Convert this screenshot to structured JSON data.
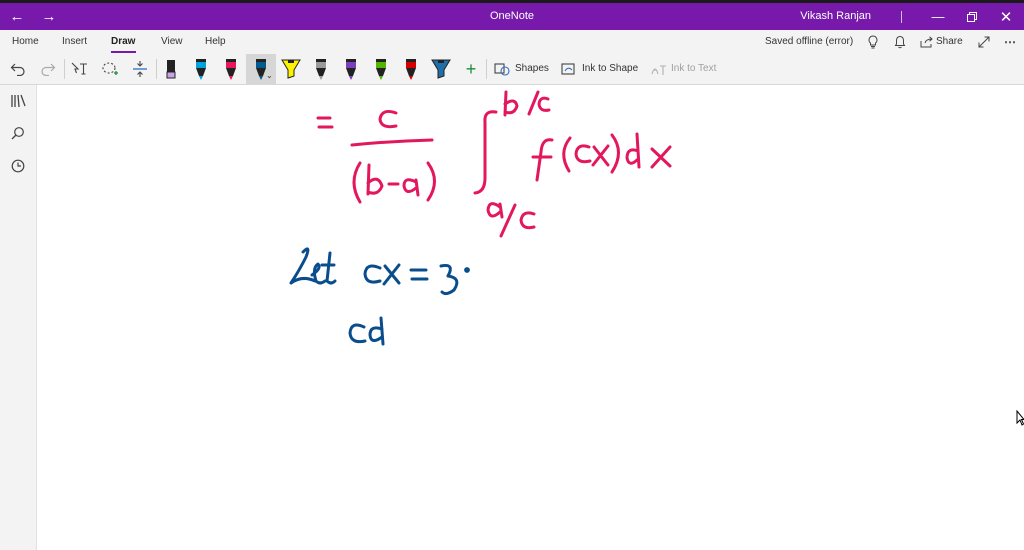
{
  "window": {
    "title": "OneNote",
    "user": "Vikash Ranjan"
  },
  "ribbon": {
    "tabs": [
      "Home",
      "Insert",
      "Draw",
      "View",
      "Help"
    ],
    "active_tab": "Draw",
    "status": "Saved offline (error)",
    "share_label": "Share"
  },
  "toolbar": {
    "shapes_label": "Shapes",
    "ink_to_shape_label": "Ink to Shape",
    "ink_to_text_label": "Ink to Text",
    "pen_colors": [
      "#c8a2e8",
      "#00a3d9",
      "#e8175d",
      "#005a8c",
      "#fff200",
      "#9a9a9a",
      "#7b3fbe",
      "#52b500",
      "#d40000",
      "#1e6ea8"
    ]
  },
  "canvas": {
    "ink_colors": {
      "magenta": "#e3175d",
      "blue": "#0a4d8c"
    },
    "handwriting": [
      "= c / (b-a) ∫ from a/c to b/c f(cx) dx",
      "Let cx = z.",
      "cd"
    ]
  },
  "colors": {
    "title_bar": "#7719aa",
    "ribbon_bg": "#f3f3f3"
  }
}
